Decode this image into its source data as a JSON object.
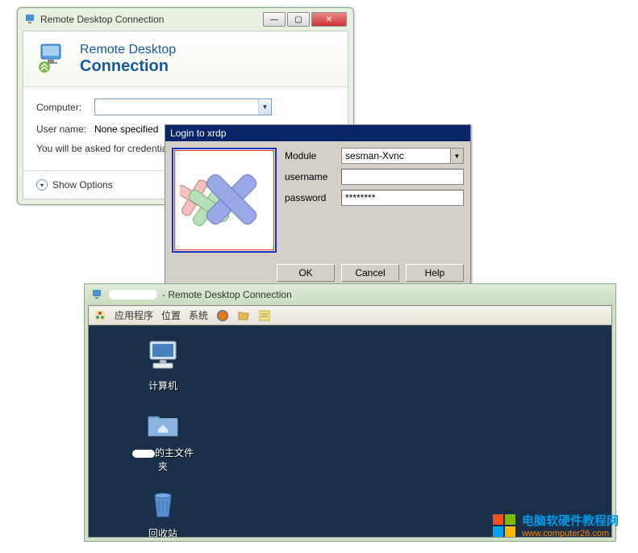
{
  "win1": {
    "title": "Remote Desktop Connection",
    "header_line1": "Remote Desktop",
    "header_line2": "Connection",
    "computer_label": "Computer:",
    "computer_value": "",
    "username_label": "User name:",
    "username_value": "None specified",
    "note": "You will be asked for credentials wh",
    "show_options": "Show Options"
  },
  "win2": {
    "title": "Login to xrdp",
    "module_label": "Module",
    "module_value": "sesman-Xvnc",
    "username_label": "username",
    "username_value": "",
    "password_label": "password",
    "password_value": "********",
    "ok": "OK",
    "cancel": "Cancel",
    "help": "Help"
  },
  "win3": {
    "title_suffix": " - Remote Desktop Connection",
    "panel": {
      "apps": "应用程序",
      "places": "位置",
      "system": "系统"
    },
    "icons": {
      "computer": "计算机",
      "home": "的主文件夹",
      "trash": "回收站"
    }
  },
  "watermark": {
    "line1": "电脑软硬件教程网",
    "line2": "www.computer26.com"
  }
}
